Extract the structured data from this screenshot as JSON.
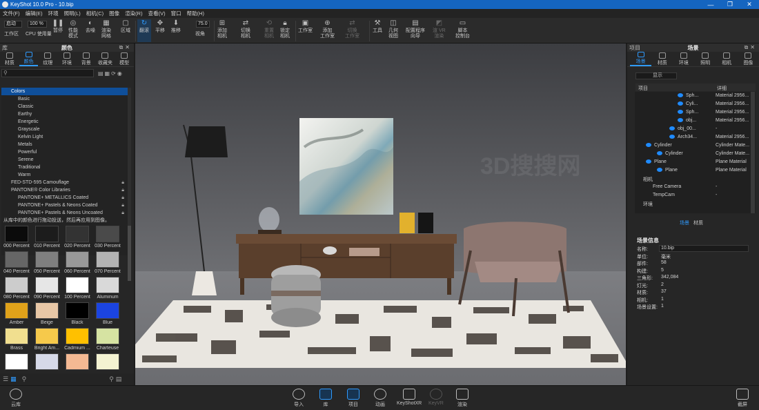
{
  "window": {
    "title": "KeyShot 10.0 Pro  -  10.bip",
    "controls": [
      "—",
      "❐",
      "✕"
    ]
  },
  "menu": [
    "文件(F)",
    "编辑(E)",
    "环境",
    "照明(L)",
    "相机(C)",
    "图像",
    "渲染(R)",
    "查看(V)",
    "窗口",
    "帮助(H)"
  ],
  "toolbar": {
    "workspace_select": "启动",
    "zoom_value": "100 %",
    "workspace_label": "工作区",
    "cpu_label": "CPU 使用量",
    "pause_label": "暂停",
    "perf_label": "性能\n模式",
    "denoise_label": "去噪",
    "render_label": "渲染\n网格",
    "region_label": "区域",
    "tumble_label": "翻滚",
    "pan_label": "平移",
    "dolly_label": "推移",
    "fov_value": "75.0",
    "view_label": "视角",
    "add_camera_label": "添加\n相机",
    "switch_camera_label": "切换\n相机",
    "reset_camera_label": "重置\n相机",
    "lock_camera_label": "锁定\n相机",
    "studio_label": "工作室",
    "add_studio_label": "添加\n工作室",
    "switch_studio_label": "切换\n工作室",
    "tools_label": "工具",
    "geometry_view_label": "几何\n视图",
    "config_wizard_label": "配置程序\n向导",
    "vr_label": "渲 VR\n渲染",
    "script_console_label": "脚本\n控制台"
  },
  "library": {
    "header_left": "库",
    "title": "颜色",
    "tabs": [
      "材质",
      "颜色",
      "纹理",
      "环境",
      "背景",
      "收藏夹",
      "模型"
    ],
    "active_tab": "颜色",
    "tree": [
      {
        "label": "Colors",
        "level": "root"
      },
      {
        "label": "Basic",
        "level": "child"
      },
      {
        "label": "Classic",
        "level": "child"
      },
      {
        "label": "Earthy",
        "level": "child"
      },
      {
        "label": "Energetic",
        "level": "child"
      },
      {
        "label": "Grayscale",
        "level": "child"
      },
      {
        "label": "Kelvin Light",
        "level": "child"
      },
      {
        "label": "Metals",
        "level": "child"
      },
      {
        "label": "Powerful",
        "level": "child"
      },
      {
        "label": "Serene",
        "level": "child"
      },
      {
        "label": "Traditional",
        "level": "child"
      },
      {
        "label": "Warm",
        "level": "child"
      },
      {
        "label": "FED-STD-595 Camouflage",
        "level": "lvl1",
        "locked": true
      },
      {
        "label": "PANTONE® Color Libraries",
        "level": "lvl1",
        "locked": true
      },
      {
        "label": "PANTONE+ METALLICS Coated",
        "level": "child",
        "locked": true
      },
      {
        "label": "PANTONE+ Pastels & Neons Coated",
        "level": "child",
        "locked": true
      },
      {
        "label": "PANTONE+ Pastels & Neons Uncoated",
        "level": "child",
        "locked": true
      }
    ],
    "hint": "从库中的颜色进行拖动投送，然后再应用到图像。",
    "swatches": [
      {
        "label": "000 Percent",
        "color": "#0b0b0b"
      },
      {
        "label": "010 Percent",
        "color": "#1c1c1c"
      },
      {
        "label": "020 Percent",
        "color": "#333333"
      },
      {
        "label": "030 Percent",
        "color": "#4a4a4a"
      },
      {
        "label": "040 Percent",
        "color": "#666666"
      },
      {
        "label": "050 Percent",
        "color": "#7f7f7f"
      },
      {
        "label": "060 Percent",
        "color": "#999999"
      },
      {
        "label": "070 Percent",
        "color": "#b3b3b3"
      },
      {
        "label": "080 Percent",
        "color": "#cccccc"
      },
      {
        "label": "090 Percent",
        "color": "#e6e6e6"
      },
      {
        "label": "100 Percent",
        "color": "#ffffff"
      },
      {
        "label": "Aluminum",
        "color": "#d9d9d9"
      },
      {
        "label": "Amber",
        "color": "#e0a21a"
      },
      {
        "label": "Beige",
        "color": "#e8c7a6"
      },
      {
        "label": "Black",
        "color": "#000000"
      },
      {
        "label": "Blue",
        "color": "#1b44e0"
      },
      {
        "label": "Brass",
        "color": "#f1df8f"
      },
      {
        "label": "Bright Am...",
        "color": "#f6c94b"
      },
      {
        "label": "Cadmium ...",
        "color": "#ffc000"
      },
      {
        "label": "Charteuse",
        "color": "#d6e3a2"
      },
      {
        "label": "",
        "color": "#ffffff"
      },
      {
        "label": "",
        "color": "#d6d9e8"
      },
      {
        "label": "",
        "color": "#f4b993"
      },
      {
        "label": "",
        "color": "#f4f3d2"
      }
    ]
  },
  "project": {
    "header_left": "项目",
    "title": "场景",
    "tabs": [
      "场景",
      "材质",
      "环境",
      "照明",
      "相机",
      "图像"
    ],
    "active_tab": "场景",
    "show_button": "显示",
    "col_item": "项目",
    "col_detail": "详细",
    "rows": [
      {
        "name": "Sph...",
        "detail": "Material 2956...",
        "indent": 74,
        "eye": true
      },
      {
        "name": "Cyli...",
        "detail": "Material 2956...",
        "indent": 74,
        "eye": true
      },
      {
        "name": "Sph...",
        "detail": "Material 2956...",
        "indent": 74,
        "eye": true
      },
      {
        "name": "obj...",
        "detail": "Material 2956...",
        "indent": 74,
        "eye": true
      },
      {
        "name": "obj_00...",
        "detail": "-",
        "indent": 62,
        "eye": true
      },
      {
        "name": "Arch34...",
        "detail": "Material 2956...",
        "indent": 62,
        "eye": true
      },
      {
        "name": "Cylinder",
        "detail": "Cylinder Mate...",
        "indent": 28,
        "eye": true
      },
      {
        "name": "Cylinder",
        "detail": "Cylinder Mate...",
        "indent": 44,
        "eye": true
      },
      {
        "name": "Plane",
        "detail": "Plane Material",
        "indent": 28,
        "eye": true
      },
      {
        "name": "Plane",
        "detail": "Plane Material",
        "indent": 44,
        "eye": true
      },
      {
        "name": "相机",
        "detail": "",
        "indent": 12,
        "eye": false
      },
      {
        "name": "Free Camera",
        "detail": "-",
        "indent": 26,
        "eye": false
      },
      {
        "name": "TempCam",
        "detail": "-",
        "indent": 26,
        "eye": false
      },
      {
        "name": "环境",
        "detail": "",
        "indent": 12,
        "eye": false
      }
    ],
    "sub_tabs": [
      "场景",
      "材质"
    ],
    "info_title": "场景信息",
    "info": [
      {
        "k": "名称:",
        "v": "10.bip"
      },
      {
        "k": "单位:",
        "v": "毫米"
      },
      {
        "k": "部件:",
        "v": "58"
      },
      {
        "k": "构建:",
        "v": "5"
      },
      {
        "k": "三角形:",
        "v": "342,084"
      },
      {
        "k": "灯光:",
        "v": "2"
      },
      {
        "k": "材质:",
        "v": "37"
      },
      {
        "k": "相机:",
        "v": "1"
      },
      {
        "k": "场景设置:",
        "v": "1"
      }
    ]
  },
  "bottom": {
    "cloud_label": "云库",
    "import_label": "导入",
    "library_label": "库",
    "project_label": "项目",
    "animation_label": "动画",
    "xr_label": "KeyShotXR",
    "keyvr_label": "KeyVR",
    "render_label": "渲染",
    "screenshot_label": "截屏"
  },
  "watermark": "3D搜搜网"
}
